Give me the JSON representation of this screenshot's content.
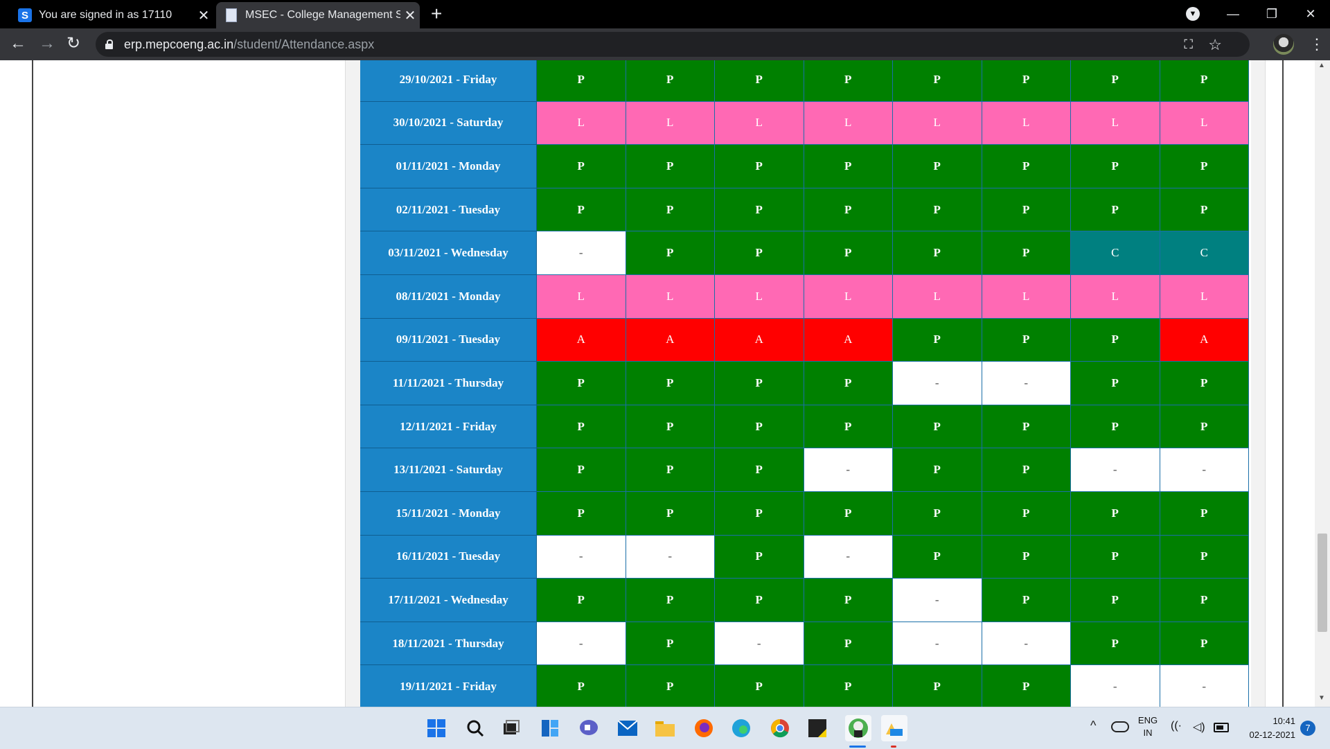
{
  "browser": {
    "tabs": [
      {
        "label": "You are signed in as 17110",
        "icon": "s-favicon-icon"
      },
      {
        "label": "MSEC - College Management Sys",
        "icon": "document-favicon-icon"
      }
    ],
    "url_host": "erp.mepcoeng.ac.in",
    "url_path": "/student/Attendance.aspx"
  },
  "attendance": {
    "rows": [
      {
        "date": "29/10/2021 - Friday",
        "cells": [
          "P",
          "P",
          "P",
          "P",
          "P",
          "P",
          "P",
          "P"
        ]
      },
      {
        "date": "30/10/2021 - Saturday",
        "cells": [
          "L",
          "L",
          "L",
          "L",
          "L",
          "L",
          "L",
          "L"
        ]
      },
      {
        "date": "01/11/2021 - Monday",
        "cells": [
          "P",
          "P",
          "P",
          "P",
          "P",
          "P",
          "P",
          "P"
        ]
      },
      {
        "date": "02/11/2021 - Tuesday",
        "cells": [
          "P",
          "P",
          "P",
          "P",
          "P",
          "P",
          "P",
          "P"
        ]
      },
      {
        "date": "03/11/2021 - Wednesday",
        "cells": [
          "-",
          "P",
          "P",
          "P",
          "P",
          "P",
          "C",
          "C"
        ]
      },
      {
        "date": "08/11/2021 - Monday",
        "cells": [
          "L",
          "L",
          "L",
          "L",
          "L",
          "L",
          "L",
          "L"
        ]
      },
      {
        "date": "09/11/2021 - Tuesday",
        "cells": [
          "A",
          "A",
          "A",
          "A",
          "P",
          "P",
          "P",
          "A"
        ]
      },
      {
        "date": "11/11/2021 - Thursday",
        "cells": [
          "P",
          "P",
          "P",
          "P",
          "-",
          "-",
          "P",
          "P"
        ]
      },
      {
        "date": "12/11/2021 - Friday",
        "cells": [
          "P",
          "P",
          "P",
          "P",
          "P",
          "P",
          "P",
          "P"
        ]
      },
      {
        "date": "13/11/2021 - Saturday",
        "cells": [
          "P",
          "P",
          "P",
          "-",
          "P",
          "P",
          "-",
          "-"
        ]
      },
      {
        "date": "15/11/2021 - Monday",
        "cells": [
          "P",
          "P",
          "P",
          "P",
          "P",
          "P",
          "P",
          "P"
        ]
      },
      {
        "date": "16/11/2021 - Tuesday",
        "cells": [
          "-",
          "-",
          "P",
          "-",
          "P",
          "P",
          "P",
          "P"
        ]
      },
      {
        "date": "17/11/2021 - Wednesday",
        "cells": [
          "P",
          "P",
          "P",
          "P",
          "-",
          "P",
          "P",
          "P"
        ]
      },
      {
        "date": "18/11/2021 - Thursday",
        "cells": [
          "-",
          "P",
          "-",
          "P",
          "-",
          "-",
          "P",
          "P"
        ]
      },
      {
        "date": "19/11/2021 - Friday",
        "cells": [
          "P",
          "P",
          "P",
          "P",
          "P",
          "P",
          "-",
          "-"
        ]
      }
    ],
    "status_colors": {
      "P": "#008000",
      "L": "#ff69b4",
      "A": "#ff0000",
      "C": "#008080",
      "-": "#ffffff"
    }
  },
  "taskbar": {
    "apps": [
      "start-icon",
      "search-icon",
      "task-view-icon",
      "widgets-icon",
      "chat-icon",
      "mail-icon",
      "file-explorer-icon",
      "firefox-icon",
      "edge-icon",
      "chrome-icon",
      "sticky-notes-icon",
      "chrome-profile-icon",
      "files-icon"
    ],
    "language_line1": "ENG",
    "language_line2": "IN",
    "time": "10:41",
    "date": "02-12-2021",
    "notification_count": "7"
  }
}
